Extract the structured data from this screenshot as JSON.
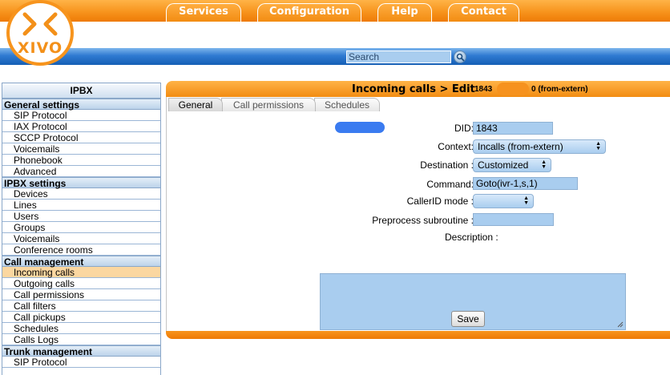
{
  "nav": {
    "services": "Services",
    "configuration": "Configuration",
    "help": "Help",
    "contact": "Contact"
  },
  "logo": {
    "text": "XIVO"
  },
  "search": {
    "placeholder": "Search"
  },
  "sidebar": {
    "title": "IPBX",
    "sections": [
      {
        "heading": "General settings",
        "items": [
          "SIP Protocol",
          "IAX Protocol",
          "SCCP Protocol",
          "Voicemails",
          "Phonebook",
          "Advanced"
        ]
      },
      {
        "heading": "IPBX settings",
        "items": [
          "Devices",
          "Lines",
          "Users",
          "Groups",
          "Voicemails",
          "Conference rooms"
        ]
      },
      {
        "heading": "Call management",
        "items": [
          "Incoming calls",
          "Outgoing calls",
          "Call permissions",
          "Call filters",
          "Call pickups",
          "Schedules",
          "Calls Logs"
        ]
      },
      {
        "heading": "Trunk management",
        "items": [
          "SIP Protocol"
        ]
      }
    ],
    "active_item": "Incoming calls"
  },
  "panel": {
    "title": "Incoming calls > Edit",
    "title_number": "1843",
    "title_context": "0 (from-extern)",
    "tabs": [
      "General",
      "Call permissions",
      "Schedules"
    ],
    "active_tab": "General"
  },
  "form": {
    "did_label": "DID:",
    "did_value": "1843",
    "context_label": "Context:",
    "context_value": "Incalls (from-extern)",
    "destination_label": "Destination :",
    "destination_value": "Customized",
    "command_label": "Command:",
    "command_value": "Goto(ivr-1,s,1)",
    "callerid_label": "CallerID mode :",
    "callerid_value": "",
    "preprocess_label": "Preprocess subroutine :",
    "preprocess_value": "",
    "description_label": "Description :",
    "description_value": "",
    "save_label": "Save"
  },
  "colors": {
    "orange": "#f7941d",
    "blue_bar": "#2f7ad1",
    "field_blue": "#a9cdef",
    "active_item": "#fbd7a0"
  }
}
